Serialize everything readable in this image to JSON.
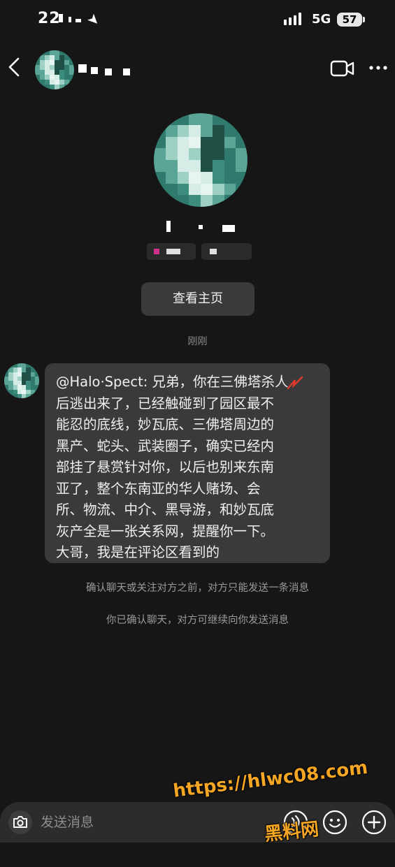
{
  "status_bar": {
    "time": "22",
    "network": "5G",
    "battery": "57"
  },
  "header": {
    "contact_name": ""
  },
  "profile": {
    "view_profile_label": "查看主页"
  },
  "chat": {
    "timestamp": "刚刚",
    "message_lines": [
      "@Halo·Spect: 兄弟，你在三佛塔杀人",
      "后逃出来了，已经触碰到了园区最不",
      "能忍的底线，妙瓦底、三佛塔周边的",
      "黑产、蛇头、武装圈子，确实已经内",
      "部挂了悬赏针对你，以后也别来东南",
      "亚了，整个东南亚的华人赌场、会",
      "所、物流、中介、黑导游，和妙瓦底",
      "灰产全是一张关系网，提醒你一下。",
      "大哥，我是在评论区看到的"
    ],
    "notice_limit": "确认聊天或关注对方之前，对方只能发送一条消息",
    "notice_confirmed": "你已确认聊天，对方可继续向你发送消息"
  },
  "input": {
    "placeholder": "发送消息"
  },
  "watermark": {
    "url": "https://hlwc08.com",
    "site_name": "黑料网"
  },
  "colors": {
    "background": "#161616",
    "bubble": "#3a3a3a",
    "accent_watermark": "#f5a623",
    "avatar_teal": "#2f7a6c"
  },
  "icons": [
    "back-arrow-icon",
    "video-call-icon",
    "more-icon",
    "camera-icon",
    "voice-icon",
    "emoji-icon",
    "plus-icon",
    "signal-icon",
    "location-arrow-icon"
  ]
}
